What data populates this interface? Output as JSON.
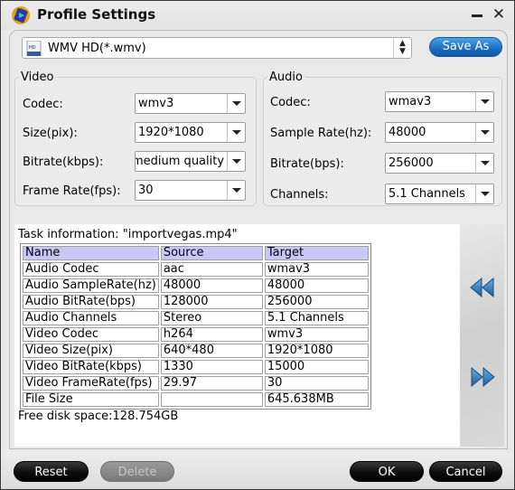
{
  "window": {
    "title": "Profile Settings",
    "icon": "app-logo-icon",
    "minimize_icon": "minimize-icon",
    "close_icon": "close-icon",
    "close_glyph": "✕"
  },
  "profile": {
    "selected": "WMV HD(*.wmv)",
    "format_icon": "wmv-file-icon",
    "arrows_up": "▲",
    "arrows_down": "▼",
    "save_as_label": "Save As"
  },
  "video": {
    "legend": "Video",
    "fields": [
      {
        "label": "Codec:",
        "value": "wmv3"
      },
      {
        "label": "Size(pix):",
        "value": "1920*1080"
      },
      {
        "label": "Bitrate(kbps):",
        "value": "medium quality"
      },
      {
        "label": "Frame Rate(fps):",
        "value": "30"
      }
    ]
  },
  "audio": {
    "legend": "Audio",
    "fields": [
      {
        "label": "Codec:",
        "value": "wmav3"
      },
      {
        "label": "Sample Rate(hz):",
        "value": "48000"
      },
      {
        "label": "Bitrate(bps):",
        "value": "256000"
      },
      {
        "label": "Channels:",
        "value": "5.1 Channels"
      }
    ]
  },
  "task_info": {
    "title": "Task information: \"importvegas.mp4\"",
    "columns": [
      "Name",
      "Source",
      "Target"
    ],
    "rows": [
      [
        "Audio Codec",
        "aac",
        "wmav3"
      ],
      [
        "Audio SampleRate(hz)",
        "48000",
        "48000"
      ],
      [
        "Audio BitRate(bps)",
        "128000",
        "256000"
      ],
      [
        "Audio Channels",
        "Stereo",
        "5.1 Channels"
      ],
      [
        "Video Codec",
        "h264",
        "wmv3"
      ],
      [
        "Video Size(pix)",
        "640*480",
        "1920*1080"
      ],
      [
        "Video BitRate(kbps)",
        "1330",
        "15000"
      ],
      [
        "Video FrameRate(fps)",
        "29.97",
        "30"
      ],
      [
        "File Size",
        "",
        "645.638MB"
      ]
    ],
    "free_space": "Free disk space:128.754GB",
    "header_color": "#c8c8f8"
  },
  "nav": {
    "prev_icon": "rewind-icon",
    "next_icon": "fast-forward-icon",
    "arrow_color": "#2f78b8"
  },
  "buttons": {
    "reset": "Reset",
    "delete": "Delete",
    "ok": "OK",
    "cancel": "Cancel"
  }
}
